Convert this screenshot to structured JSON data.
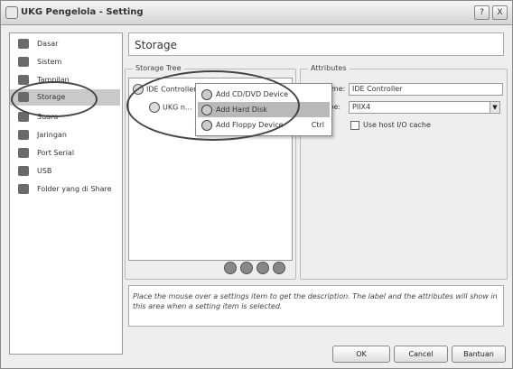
{
  "window": {
    "title": "UKG Pengelola - Setting",
    "help_btn": "?",
    "close_btn": "X"
  },
  "sidebar": {
    "items": [
      {
        "label": "Dasar",
        "icon": "general-icon"
      },
      {
        "label": "Sistem",
        "icon": "system-icon"
      },
      {
        "label": "Tampilan",
        "icon": "display-icon"
      },
      {
        "label": "Storage",
        "icon": "storage-icon"
      },
      {
        "label": "Suara",
        "icon": "audio-icon"
      },
      {
        "label": "Jaringan",
        "icon": "network-icon"
      },
      {
        "label": "Port Serial",
        "icon": "serial-port-icon"
      },
      {
        "label": "USB",
        "icon": "usb-icon"
      },
      {
        "label": "Folder yang di Share",
        "icon": "shared-folder-icon"
      }
    ]
  },
  "header": {
    "title": "Storage"
  },
  "storage_tree": {
    "group_label": "Storage Tree",
    "controller_label": "IDE Controller",
    "device_label": "UKG n..."
  },
  "context_menu": {
    "items": [
      {
        "label": "Add CD/DVD Device",
        "shortcut": ""
      },
      {
        "label": "Add Hard Disk",
        "shortcut": ""
      },
      {
        "label": "Add Floppy Device",
        "shortcut": "Ctrl"
      }
    ]
  },
  "attributes": {
    "group_label": "Attributes",
    "name_label": "Name:",
    "name_value": "IDE Controller",
    "type_label": "Type:",
    "type_value": "PIIX4",
    "use_cache_label": "Use host I/O cache"
  },
  "info": {
    "text": "Place the mouse over a settings item to get the description. The label and the attributes will show in this area when a setting item is selected."
  },
  "buttons": {
    "ok": "OK",
    "cancel": "Cancel",
    "help": "Bantuan"
  },
  "accent_colors": {
    "selected_bg": "#c9c9c9",
    "highlight_bg": "#b9b9b9"
  }
}
